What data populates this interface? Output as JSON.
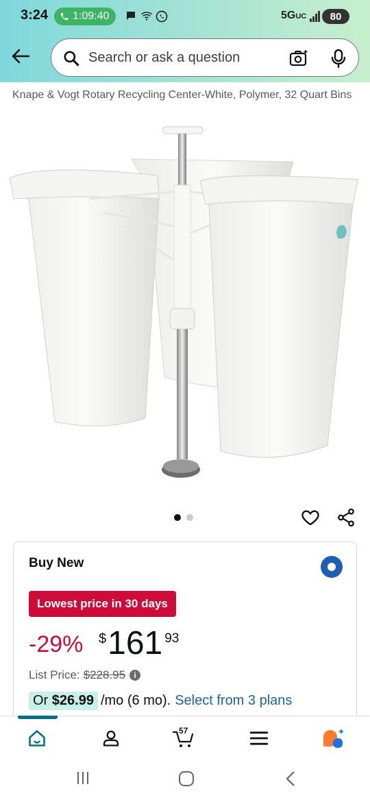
{
  "status_bar": {
    "time": "3:24",
    "call_timer": "1:09:40",
    "network": "5G",
    "network_sub": "UC",
    "battery": "80"
  },
  "search": {
    "placeholder": "Search or ask a question"
  },
  "product": {
    "title": "Knape & Vogt Rotary Recycling Center-White, Polymer, 32 Quart Bins",
    "image_count": 2,
    "active_image": 1
  },
  "buy_box": {
    "title": "Buy New",
    "deal_badge": "Lowest price in 30 days",
    "discount": "-29%",
    "price_symbol": "$",
    "price_whole": "161",
    "price_fraction": "93",
    "list_price_label": "List Price:",
    "list_price": "$228.95",
    "installment_or": "Or",
    "installment_amount": "$26.99",
    "installment_term": "/mo (6 mo).",
    "installment_link": "Select from 3 plans"
  },
  "bottom_nav": {
    "cart_count": "57",
    "items": [
      "home-icon",
      "account-icon",
      "cart-icon",
      "menu-icon",
      "rufus-icon"
    ]
  },
  "colors": {
    "accent_teal": "#007185",
    "deal_red": "#cc0c39",
    "link_blue": "#2162a1",
    "radio_blue": "#1f5eb0"
  }
}
